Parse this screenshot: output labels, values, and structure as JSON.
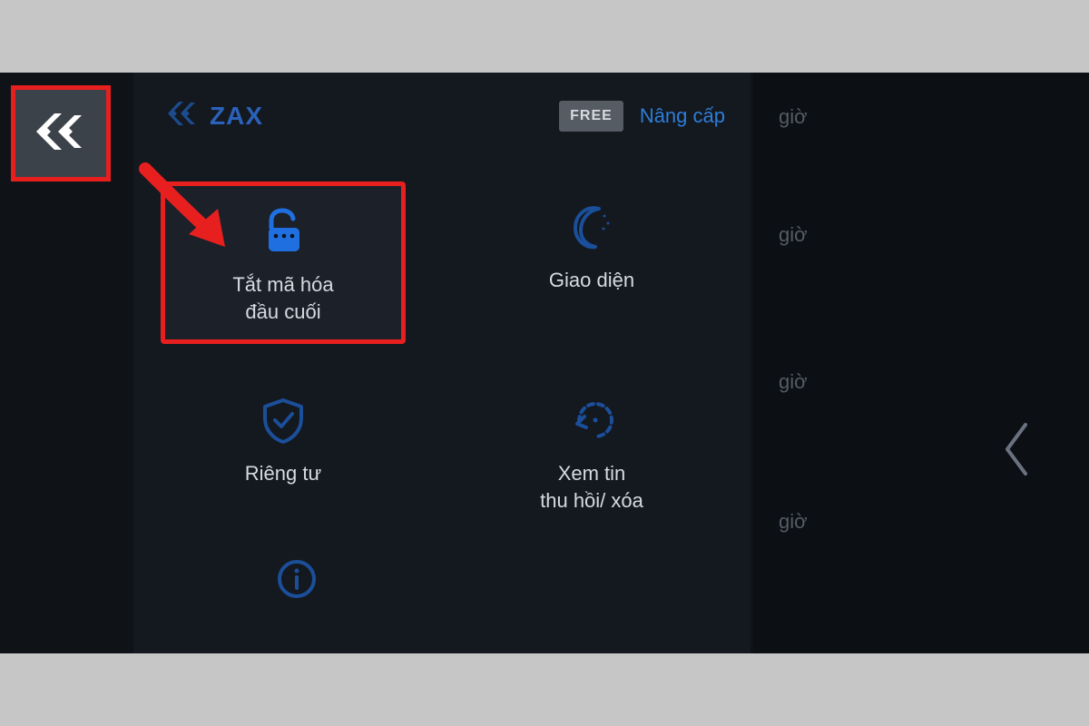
{
  "app": {
    "name": "ZAX",
    "badge": "FREE",
    "upgrade_link": "Nâng cấp"
  },
  "menu": {
    "encryption": {
      "label": "Tắt mã hóa\nđầu cuối"
    },
    "appearance": {
      "label": "Giao diện"
    },
    "privacy": {
      "label": "Riêng tư"
    },
    "recall": {
      "label": "Xem tin\nthu hồi/ xóa"
    }
  },
  "right": {
    "time_labels": [
      "giờ",
      "giờ",
      "giờ",
      "giờ"
    ]
  },
  "colors": {
    "accent": "#1f6fe0",
    "highlight": "#e81f1f"
  }
}
